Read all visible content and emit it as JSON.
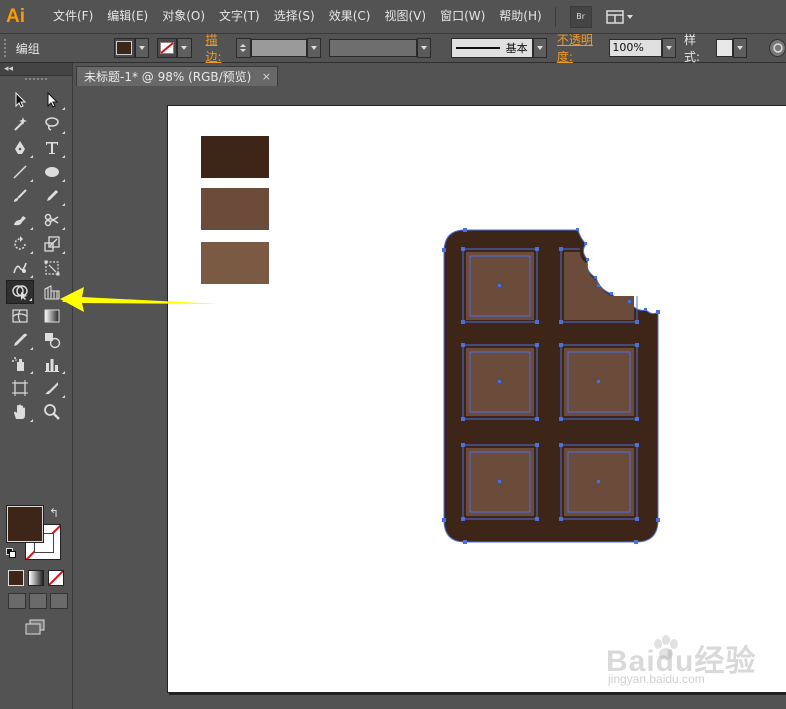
{
  "app": {
    "logo": "Ai",
    "menu": [
      "文件(F)",
      "编辑(E)",
      "对象(O)",
      "文字(T)",
      "选择(S)",
      "效果(C)",
      "视图(V)",
      "窗口(W)",
      "帮助(H)"
    ],
    "bridge_label": "Br"
  },
  "control_bar": {
    "selection_label": "编组",
    "stroke_label": "描边:",
    "stroke_style_label": "基本",
    "opacity_label": "不透明度:",
    "opacity_value": "100%",
    "style_label": "样式:",
    "fill_color": "#3d2618"
  },
  "tools_panel": {
    "collapse_glyph": "◂◂",
    "tools": [
      {
        "left": "selection-icon",
        "right": "direct-selection-icon"
      },
      {
        "left": "magic-wand-icon",
        "right": "lasso-icon"
      },
      {
        "left": "pen-icon",
        "right": "type-icon"
      },
      {
        "left": "line-segment-icon",
        "right": "ellipse-icon"
      },
      {
        "left": "paintbrush-icon",
        "right": "pencil-icon"
      },
      {
        "left": "blob-brush-icon",
        "right": "scissors-icon"
      },
      {
        "left": "rotate-icon",
        "right": "scale-icon"
      },
      {
        "left": "warp-icon",
        "right": "free-transform-icon"
      },
      {
        "left": "shape-builder-icon",
        "right": "perspective-grid-icon"
      },
      {
        "left": "mesh-icon",
        "right": "gradient-icon"
      },
      {
        "left": "eyedropper-icon",
        "right": "blend-icon"
      },
      {
        "left": "symbol-sprayer-icon",
        "right": "column-graph-icon"
      },
      {
        "left": "artboard-icon",
        "right": "slice-icon"
      },
      {
        "left": "hand-icon",
        "right": "zoom-icon"
      }
    ],
    "active_tool": "shape-builder-icon",
    "fill_color": "#3d2618",
    "stroke": "none"
  },
  "document": {
    "tab_title": "未标题-1* @ 98% (RGB/预览)",
    "close_glyph": "×"
  },
  "swatches": [
    "#3d2618",
    "#6b4b3a",
    "#7b5a44"
  ],
  "chocolate": {
    "body_color": "#3d2618",
    "square_color": "#6b4b3a",
    "selection_color": "#4a6fe0"
  },
  "watermark": {
    "text": "Baidu经验",
    "url": "jingyan.baidu.com"
  }
}
